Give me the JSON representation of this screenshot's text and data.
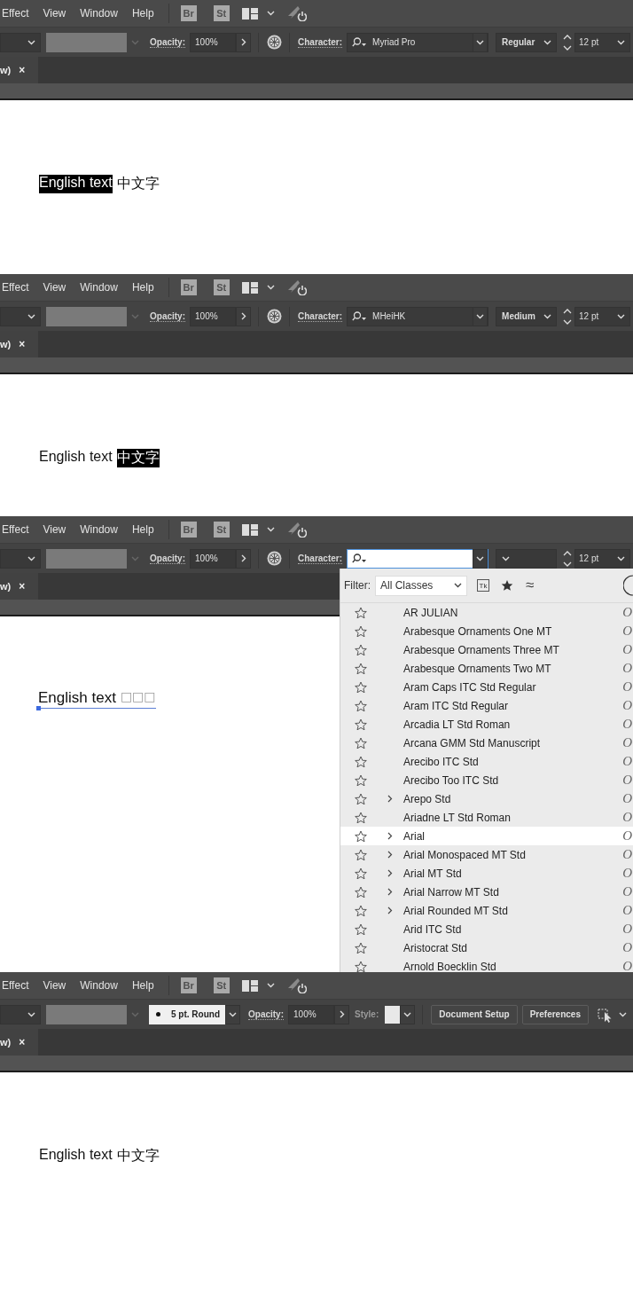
{
  "panels": [
    {
      "menu": [
        {
          "label": "Effect"
        },
        {
          "label": "View"
        },
        {
          "label": "Window"
        },
        {
          "label": "Help"
        }
      ],
      "app_badges": [
        "Br",
        "St"
      ],
      "control_bar": {
        "kind": "character",
        "opacity_label": "Opacity:",
        "opacity": "100%",
        "character_label": "Character:",
        "font": {
          "value": "Myriad Pro",
          "focused": false
        },
        "style": "Regular",
        "size": "12 pt"
      },
      "document_tab": {
        "title": "w)",
        "close": "×"
      },
      "canvas": {
        "selected_path": false,
        "segments": [
          {
            "text": "English text",
            "highlighted": true,
            "missing_glyphs": false
          },
          {
            "text": "中文字",
            "highlighted": false,
            "missing_glyphs": false
          }
        ]
      }
    },
    {
      "menu": [
        {
          "label": "Effect"
        },
        {
          "label": "View"
        },
        {
          "label": "Window"
        },
        {
          "label": "Help"
        }
      ],
      "app_badges": [
        "Br",
        "St"
      ],
      "control_bar": {
        "kind": "character",
        "opacity_label": "Opacity:",
        "opacity": "100%",
        "character_label": "Character:",
        "font": {
          "value": "MHeiHK",
          "focused": false
        },
        "style": "Medium",
        "size": "12 pt"
      },
      "document_tab": {
        "title": "w)",
        "close": "×"
      },
      "canvas": {
        "selected_path": false,
        "segments": [
          {
            "text": "English text",
            "highlighted": false,
            "missing_glyphs": false
          },
          {
            "text": "中文字",
            "highlighted": true,
            "missing_glyphs": false
          }
        ]
      }
    },
    {
      "menu": [
        {
          "label": "Effect"
        },
        {
          "label": "View"
        },
        {
          "label": "Window"
        },
        {
          "label": "Help"
        }
      ],
      "app_badges": [
        "Br",
        "St"
      ],
      "control_bar": {
        "kind": "character",
        "opacity_label": "Opacity:",
        "opacity": "100%",
        "character_label": "Character:",
        "font": {
          "focused": true
        },
        "size": "12 pt"
      },
      "document_tab": {
        "title": "w)",
        "close": "×"
      },
      "canvas": {
        "selected_path": true,
        "segments": [
          {
            "text": "English text",
            "highlighted": false,
            "missing_glyphs": false
          },
          {
            "text": "□□□",
            "highlighted": false,
            "missing_glyphs": true
          }
        ]
      },
      "font_menu": {
        "filter_label": "Filter:",
        "filter": "All Classes",
        "typekit_badge": "Tk",
        "similar_symbol": "≈",
        "fonts": [
          {
            "name": "AR JULIAN",
            "has_children": false,
            "highlighted": false,
            "sample": "O"
          },
          {
            "name": "Arabesque Ornaments One MT",
            "has_children": false,
            "highlighted": false,
            "sample": "O"
          },
          {
            "name": "Arabesque Ornaments Three MT",
            "has_children": false,
            "highlighted": false,
            "sample": "O"
          },
          {
            "name": "Arabesque Ornaments Two MT",
            "has_children": false,
            "highlighted": false,
            "sample": "O"
          },
          {
            "name": "Aram Caps ITC Std Regular",
            "has_children": false,
            "highlighted": false,
            "sample": "O"
          },
          {
            "name": "Aram ITC Std Regular",
            "has_children": false,
            "highlighted": false,
            "sample": "O"
          },
          {
            "name": "Arcadia LT Std Roman",
            "has_children": false,
            "highlighted": false,
            "sample": "O"
          },
          {
            "name": "Arcana GMM Std Manuscript",
            "has_children": false,
            "highlighted": false,
            "sample": "O"
          },
          {
            "name": "Arecibo ITC Std",
            "has_children": false,
            "highlighted": false,
            "sample": "O"
          },
          {
            "name": "Arecibo Too ITC Std",
            "has_children": false,
            "highlighted": false,
            "sample": "O"
          },
          {
            "name": "Arepo Std",
            "has_children": true,
            "highlighted": false,
            "sample": "O"
          },
          {
            "name": "Ariadne LT Std Roman",
            "has_children": false,
            "highlighted": false,
            "sample": "O"
          },
          {
            "name": "Arial",
            "has_children": true,
            "highlighted": true,
            "sample": "O"
          },
          {
            "name": "Arial Monospaced MT Std",
            "has_children": true,
            "highlighted": false,
            "sample": "O"
          },
          {
            "name": "Arial MT Std",
            "has_children": true,
            "highlighted": false,
            "sample": "O"
          },
          {
            "name": "Arial Narrow MT Std",
            "has_children": true,
            "highlighted": false,
            "sample": "O"
          },
          {
            "name": "Arial Rounded MT Std",
            "has_children": true,
            "highlighted": false,
            "sample": "O"
          },
          {
            "name": "Arid ITC Std",
            "has_children": false,
            "highlighted": false,
            "sample": "O"
          },
          {
            "name": "Aristocrat Std",
            "has_children": false,
            "highlighted": false,
            "sample": "O"
          },
          {
            "name": "Arnold Boecklin Std",
            "has_children": false,
            "highlighted": false,
            "sample": "O"
          }
        ]
      }
    },
    {
      "menu": [
        {
          "label": "Effect"
        },
        {
          "label": "View"
        },
        {
          "label": "Window"
        },
        {
          "label": "Help"
        }
      ],
      "app_badges": [
        "Br",
        "St"
      ],
      "control_bar": {
        "kind": "document",
        "brush": "5 pt. Round",
        "opacity_label": "Opacity:",
        "opacity": "100%",
        "style_label": "Style:",
        "buttons": [
          "Document Setup",
          "Preferences"
        ]
      },
      "document_tab": {
        "title": "w)",
        "close": "×"
      },
      "canvas": {
        "selected_path": false,
        "segments": [
          {
            "text": "English text",
            "highlighted": false,
            "missing_glyphs": false
          },
          {
            "text": "中文字",
            "highlighted": false,
            "missing_glyphs": false
          }
        ]
      }
    }
  ]
}
